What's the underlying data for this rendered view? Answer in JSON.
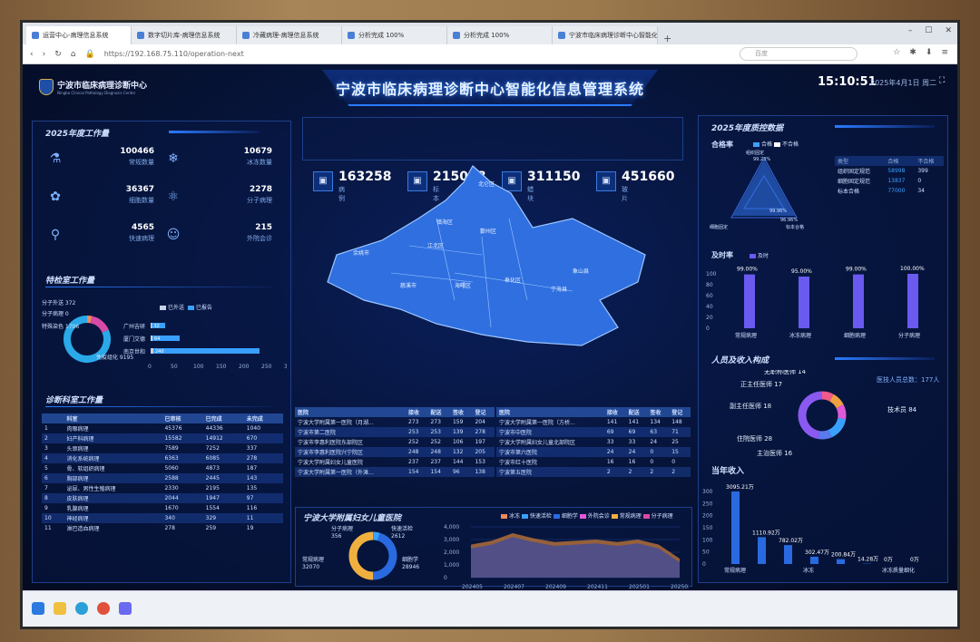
{
  "browser": {
    "tabs": [
      "运营中心-病理信息系统",
      "数字切片库-病理信息系统",
      "冷藏病理-病理信息系统",
      "分析完成 100%",
      "分析完成 100%",
      "宁波市临床病理诊断中心智能化..."
    ],
    "url": "https://192.168.75.110/operation-next",
    "search_placeholder": "百度"
  },
  "header": {
    "org": "宁波市临床病理诊断中心",
    "org_sub": "Ningbo Clinical Pathology Diagnosis Center",
    "title": "宁波市临床病理诊断中心智能化信息管理系统",
    "time": "15:10:51",
    "date": "2025年4月1日 周二"
  },
  "left": {
    "workload_title": "2025年度工作量",
    "workload": [
      {
        "value": "100466",
        "label": "常规数量",
        "icon": "microscope-icon"
      },
      {
        "value": "10679",
        "label": "冰冻数量",
        "icon": "frozen-icon"
      },
      {
        "value": "36367",
        "label": "细胞数量",
        "icon": "cell-icon"
      },
      {
        "value": "2278",
        "label": "分子病理",
        "icon": "molecule-icon"
      },
      {
        "value": "4565",
        "label": "快速病理",
        "icon": "search-icon"
      },
      {
        "value": "215",
        "label": "外院会诊",
        "icon": "users-icon"
      }
    ],
    "special_title": "特检室工作量",
    "donut": [
      {
        "label": "分子外送",
        "value": 372,
        "color": "#f08a5a"
      },
      {
        "label": "分子病理",
        "value": 0,
        "color": "#7a5ae0"
      },
      {
        "label": "特殊染色",
        "value": 1706,
        "color": "#d84aa8"
      },
      {
        "label": "免疫组化",
        "value": 9195,
        "color": "#2aa8e8"
      }
    ],
    "bar_legend": [
      "已外送",
      "已报告"
    ],
    "bars": [
      {
        "name": "广州吉研",
        "sent": 3,
        "reported": 32
      },
      {
        "name": "厦门艾德",
        "sent": 4,
        "reported": 64
      },
      {
        "name": "南京世和",
        "sent": 6,
        "reported": 240
      }
    ],
    "bar_ticks": [
      "0",
      "50",
      "100",
      "150",
      "200",
      "250",
      "300"
    ],
    "diag_title": "诊断科室工作量",
    "diag_headers": [
      "科室",
      "已审核",
      "已完成",
      "未完成"
    ],
    "diag_rows": [
      [
        "1",
        "肉眼病理",
        "45376",
        "44336",
        "1040"
      ],
      [
        "2",
        "妇产科病理",
        "15582",
        "14912",
        "670"
      ],
      [
        "3",
        "头颈病理",
        "7589",
        "7252",
        "337"
      ],
      [
        "4",
        "消化系统病理",
        "6363",
        "6085",
        "278"
      ],
      [
        "5",
        "骨、软组织病理",
        "5060",
        "4873",
        "187"
      ],
      [
        "6",
        "胸部病理",
        "2588",
        "2445",
        "143"
      ],
      [
        "7",
        "泌尿、男性生殖病理",
        "2330",
        "2195",
        "135"
      ],
      [
        "8",
        "皮肤病理",
        "2044",
        "1947",
        "97"
      ],
      [
        "9",
        "乳腺病理",
        "1670",
        "1554",
        "116"
      ],
      [
        "10",
        "神经病理",
        "340",
        "329",
        "11"
      ],
      [
        "11",
        "淋巴造血病理",
        "278",
        "259",
        "19"
      ]
    ]
  },
  "center": {
    "stats": [
      {
        "value": "163258",
        "label": "病例"
      },
      {
        "value": "215018",
        "label": "标本"
      },
      {
        "value": "311150",
        "label": "蜡块"
      },
      {
        "value": "451660",
        "label": "玻片"
      }
    ],
    "map_labels": [
      "北仑区",
      "镇海区",
      "鄞州区",
      "江北区",
      "海曙区",
      "象山县",
      "余姚市",
      "慈溪市",
      "奉化区",
      "宁海县"
    ],
    "hosp_headers": [
      "医院",
      "接收",
      "配送",
      "签收",
      "登记"
    ],
    "hosp_rows_left": [
      [
        "宁波大学附属第一医院（月湖...",
        "273",
        "273",
        "159",
        "204"
      ],
      [
        "宁波市第二医院",
        "253",
        "253",
        "139",
        "278"
      ],
      [
        "宁波市李惠利医院东部院区",
        "252",
        "252",
        "106",
        "197"
      ],
      [
        "宁波市李惠利医院兴宁院区",
        "248",
        "248",
        "132",
        "205"
      ],
      [
        "宁波大学附属妇女儿童医院",
        "237",
        "237",
        "144",
        "153"
      ],
      [
        "宁波大学附属第一医院（外滩...",
        "154",
        "154",
        "96",
        "138"
      ]
    ],
    "hosp_rows_right": [
      [
        "宁波大学附属第一医院（方桥...",
        "141",
        "141",
        "134",
        "148"
      ],
      [
        "宁波市中医院",
        "69",
        "69",
        "63",
        "71"
      ],
      [
        "宁波大学附属妇女儿童北部院区",
        "33",
        "33",
        "24",
        "25"
      ],
      [
        "宁波市第六医院",
        "24",
        "24",
        "0",
        "15"
      ],
      [
        "宁波市红十医院",
        "16",
        "16",
        "0",
        "0"
      ],
      [
        "宁波第五医院",
        "2",
        "2",
        "2",
        "2"
      ]
    ],
    "trend_title": "宁波大学附属妇女儿童医院",
    "trend_legend": [
      "冰冻",
      "快速活检",
      "细胞学",
      "外院会诊",
      "常规病理",
      "分子病理"
    ],
    "trend_donut": [
      {
        "label": "分子病理",
        "value": 356,
        "color": "#e07a4a"
      },
      {
        "label": "快速活检",
        "value": 2612,
        "color": "#3aa0ff"
      },
      {
        "label": "细胞学",
        "value": 28946,
        "color": "#2a6ae0"
      },
      {
        "label": "常规病理",
        "value": 32070,
        "color": "#f0b040"
      }
    ]
  },
  "right": {
    "quality_title": "2025年度质控数据",
    "pass_title": "合格率",
    "pass_legend": [
      "合格",
      "不合格"
    ],
    "radar_labels": [
      "组织固定",
      "99.23%",
      "细胞固定",
      "96.96%",
      "标本合格"
    ],
    "radar_tick": "99.96%",
    "qc_headers": [
      "类型",
      "合格",
      "不合格"
    ],
    "qc_rows": [
      [
        "组织固定规范",
        "58998",
        "399"
      ],
      [
        "细胞固定规范",
        "13837",
        "0"
      ],
      [
        "标本合格",
        "77000",
        "34"
      ]
    ],
    "timely_title": "及时率",
    "timely_legend": "及时",
    "timely": [
      {
        "label": "常规病理",
        "value": 99.0,
        "text": "99.00%"
      },
      {
        "label": "冰冻病理",
        "value": 95.0,
        "text": "95.00%"
      },
      {
        "label": "细胞病理",
        "value": 99.0,
        "text": "99.00%"
      },
      {
        "label": "分子病理",
        "value": 100.0,
        "text": "100.00%"
      }
    ],
    "timely_ticks": [
      "100",
      "80",
      "60",
      "40",
      "20",
      "0"
    ],
    "staff_title": "人员及收入构成",
    "staff_total": "医技人员总数：177人",
    "staff": [
      {
        "label": "无职称医师",
        "value": 14,
        "color": "#f05a8a"
      },
      {
        "label": "正主任医师",
        "value": 17,
        "color": "#f0a040"
      },
      {
        "label": "副主任医师",
        "value": 18,
        "color": "#e05ad8"
      },
      {
        "label": "住院医师",
        "value": 28,
        "color": "#3aa0ff"
      },
      {
        "label": "主治医师",
        "value": 16,
        "color": "#5a7af0"
      },
      {
        "label": "技术员",
        "value": 84,
        "color": "#8a5af0"
      }
    ],
    "income_title": "当年收入",
    "income": [
      {
        "label": "常规病理",
        "value": 3095.21,
        "text": "3095.21万"
      },
      {
        "label": "",
        "value": 1110.92,
        "text": "1110.92万"
      },
      {
        "label": "",
        "value": 782.02,
        "text": "782.02万"
      },
      {
        "label": "冰冻",
        "value": 302.47,
        "text": "302.47万"
      },
      {
        "label": "",
        "value": 200.84,
        "text": "200.84万"
      },
      {
        "label": "",
        "value": 14.28,
        "text": "14.28万"
      },
      {
        "label": "冰冻质量细化",
        "value": 0,
        "text": "0万"
      },
      {
        "label": "",
        "value": 0,
        "text": "0万"
      }
    ],
    "income_ticks": [
      "300",
      "250",
      "200",
      "150",
      "100",
      "50",
      "0"
    ]
  },
  "chart_data": [
    {
      "type": "bar",
      "title": "特检室工作量",
      "categories": [
        "广州吉研",
        "厦门艾德",
        "南京世和"
      ],
      "series": [
        {
          "name": "已外送",
          "values": [
            3,
            4,
            6
          ]
        },
        {
          "name": "已报告",
          "values": [
            32,
            64,
            240
          ]
        }
      ],
      "xlim": [
        0,
        300
      ]
    },
    {
      "type": "pie",
      "title": "特检室工作量",
      "categories": [
        "分子外送",
        "分子病理",
        "特殊染色",
        "免疫组化"
      ],
      "values": [
        372,
        0,
        1706,
        9195
      ]
    },
    {
      "type": "area",
      "title": "宁波大学附属妇女儿童医院",
      "x": [
        "202405",
        "202406",
        "202407",
        "202408",
        "202409",
        "202410",
        "202411",
        "202412",
        "202501",
        "202502",
        "202503"
      ],
      "ylim": [
        0,
        4000
      ],
      "yticks": [
        "0",
        "1,000",
        "2,000",
        "3,000",
        "4,000"
      ],
      "series": [
        {
          "name": "常规病理",
          "values": [
            2600,
            2900,
            3500,
            3100,
            2800,
            2900,
            3000,
            2800,
            3000,
            2600,
            1500
          ]
        },
        {
          "name": "细胞学",
          "values": [
            2300,
            2600,
            3200,
            2800,
            2500,
            2600,
            2700,
            2500,
            2700,
            2300,
            1200
          ]
        }
      ]
    },
    {
      "type": "pie",
      "title": "宁波大学附属妇女儿童医院",
      "categories": [
        "分子病理",
        "快速活检",
        "细胞学",
        "常规病理"
      ],
      "values": [
        356,
        2612,
        28946,
        32070
      ]
    },
    {
      "type": "bar",
      "title": "及时率",
      "categories": [
        "常规病理",
        "冰冻病理",
        "细胞病理",
        "分子病理"
      ],
      "values": [
        99.0,
        95.0,
        99.0,
        100.0
      ],
      "ylim": [
        0,
        100
      ]
    },
    {
      "type": "pie",
      "title": "人员及收入构成",
      "categories": [
        "无职称医师",
        "正主任医师",
        "副主任医师",
        "住院医师",
        "主治医师",
        "技术员"
      ],
      "values": [
        14,
        17,
        18,
        28,
        16,
        84
      ]
    },
    {
      "type": "bar",
      "title": "当年收入",
      "values": [
        3095.21,
        1110.92,
        782.02,
        302.47,
        200.84,
        14.28,
        0,
        0
      ]
    }
  ],
  "taskbar": {
    "icons": [
      "windows-icon",
      "file-explorer-icon",
      "edge-icon",
      "chrome-icon",
      "app-icon"
    ]
  }
}
